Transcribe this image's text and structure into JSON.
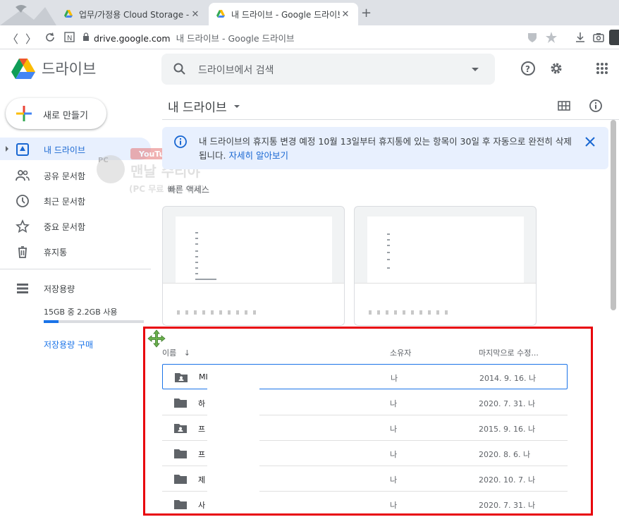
{
  "browser": {
    "tabs": [
      {
        "title": "업무/가정용 Cloud Storage - Go",
        "active": false
      },
      {
        "title": "내 드라이브 - Google 드라이브",
        "active": true
      }
    ],
    "url_domain": "drive.google.com",
    "url_rest": "내 드라이브 - Google 드라이브"
  },
  "header": {
    "brand": "드라이브",
    "search_placeholder": "드라이브에서 검색"
  },
  "sidebar": {
    "new_button": "새로 만들기",
    "items": [
      {
        "label": "내 드라이브",
        "icon": "my-drive-icon",
        "selected": true
      },
      {
        "label": "공유 문서함",
        "icon": "shared-icon",
        "selected": false
      },
      {
        "label": "최근 문서함",
        "icon": "clock-icon",
        "selected": false
      },
      {
        "label": "중요 문서함",
        "icon": "star-icon",
        "selected": false
      },
      {
        "label": "휴지통",
        "icon": "trash-icon",
        "selected": false
      }
    ],
    "storage_label": "저장용량",
    "storage_usage": "15GB 중 2.2GB 사용",
    "storage_fraction": 0.15,
    "buy_storage": "저장용량 구매"
  },
  "main": {
    "title": "내 드라이브",
    "banner_text": "내 드라이브의 휴지통 변경 예정 10월 13일부터 휴지통에 있는 항목이 30일 후 자동으로 완전히 삭제됩니다.",
    "banner_link": "자세히 알아보기",
    "quick_access": "빠른 액세스",
    "columns": {
      "name": "이름",
      "owner": "소유자",
      "modified": "마지막으로 수정..."
    },
    "files": [
      {
        "name": "MI",
        "type": "shared-folder",
        "owner": "나",
        "modified": "2014. 9. 16. 나"
      },
      {
        "name": "하",
        "type": "folder",
        "owner": "나",
        "modified": "2020. 7. 31. 나"
      },
      {
        "name": "프",
        "type": "shared-folder",
        "owner": "나",
        "modified": "2015. 9. 16. 나"
      },
      {
        "name": "프",
        "type": "folder",
        "owner": "나",
        "modified": "2020. 8. 6. 나"
      },
      {
        "name": "제",
        "type": "folder",
        "owner": "나",
        "modified": "2020. 10. 7. 나"
      },
      {
        "name": "사",
        "type": "folder",
        "owner": "나",
        "modified": "2020. 7. 31. 나"
      }
    ]
  },
  "watermark": {
    "line1": "맨날 수리야",
    "line2": "(PC 무료 셀프 수리)",
    "youtube": "YouTube",
    "badge": "PC"
  },
  "colors": {
    "accent": "#1a73e8",
    "highlight": "#e8000b",
    "selected_bg": "#e8f0fe"
  }
}
